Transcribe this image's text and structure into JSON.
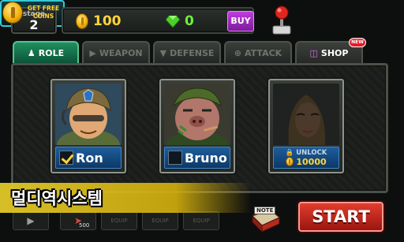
{
  "top_bar": {
    "stage_label": "stage",
    "stage_number": "2",
    "gold_amount": "100",
    "gem_amount": "0",
    "buy_label": "BUY",
    "free_coins_label": "GET FREE COINS"
  },
  "tabs": [
    {
      "label": "ROLE",
      "icon": "person-icon",
      "active": true
    },
    {
      "label": "WEAPON",
      "icon": "gun-icon",
      "active": false
    },
    {
      "label": "DEFENSE",
      "icon": "shield-icon",
      "active": false
    },
    {
      "label": "ATTACK",
      "icon": "crosshair-icon",
      "active": false
    },
    {
      "label": "SHOP",
      "icon": "basket-icon",
      "active": false
    }
  ],
  "new_badge": "NEW",
  "characters": [
    {
      "name": "Ron",
      "selected": true
    },
    {
      "name": "Bruno",
      "selected": false
    },
    {
      "unlock_label": "UNLOCK",
      "price": "10000",
      "locked": true
    }
  ],
  "banner_text": "멀디역시스템",
  "bottom": {
    "slot_label": "EQUIP",
    "weapon_value": "500",
    "note_label": "NOTE",
    "start_label": "START"
  },
  "colors": {
    "accent_tab": "#1f8f5e",
    "start": "#e23c2e",
    "gold": "#ffd43a",
    "gem": "#6df03a",
    "buy": "#c13be0"
  }
}
